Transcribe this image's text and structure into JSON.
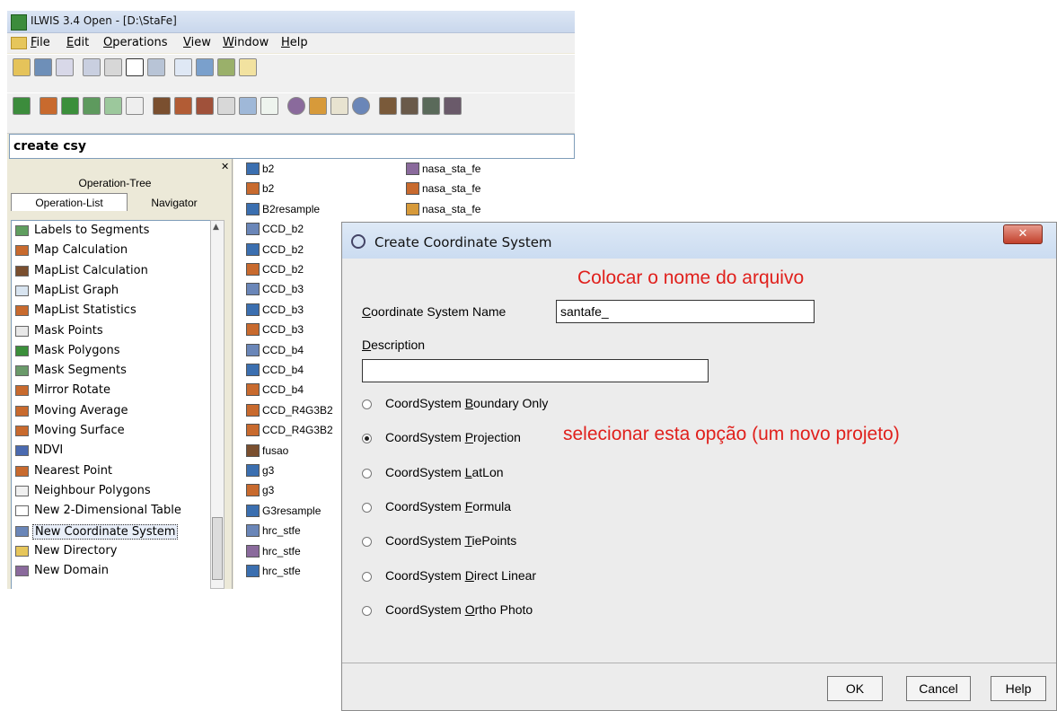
{
  "main_window": {
    "title": "ILWIS 3.4 Open - [D:\\StaFe]",
    "menu": [
      "File",
      "Edit",
      "Operations",
      "View",
      "Window",
      "Help"
    ],
    "command_line": "create csy",
    "panel_tabs": {
      "tree": "Operation-Tree",
      "list": "Operation-List",
      "navigator": "Navigator"
    },
    "operations": [
      "Labels to Segments",
      "Map Calculation",
      "MapList Calculation",
      "MapList Graph",
      "MapList Statistics",
      "Mask Points",
      "Mask Polygons",
      "Mask Segments",
      "Mirror Rotate",
      "Moving Average",
      "Moving Surface",
      "NDVI",
      "Nearest Point",
      "Neighbour Polygons",
      "New 2-Dimensional Table",
      "New Coordinate System",
      "New Directory",
      "New Domain"
    ],
    "selected_operation": "New Coordinate System",
    "catalog_col1": [
      "b2",
      "b2",
      "B2resample",
      "CCD_b2",
      "CCD_b2",
      "CCD_b2",
      "CCD_b3",
      "CCD_b3",
      "CCD_b3",
      "CCD_b4",
      "CCD_b4",
      "CCD_b4",
      "CCD_R4G3B2",
      "CCD_R4G3B2",
      "fusao",
      "g3",
      "g3",
      "G3resample",
      "hrc_stfe",
      "hrc_stfe",
      "hrc_stfe"
    ],
    "catalog_col2": [
      "nasa_sta_fe",
      "nasa_sta_fe",
      "nasa_sta_fe"
    ]
  },
  "dialog": {
    "title": "Create Coordinate System",
    "annotation_name": "Colocar o nome do arquivo",
    "name_label": "Coordinate System Name",
    "name_value": "santafe_",
    "description_label": "Description",
    "description_value": "",
    "options": [
      {
        "pre": "CoordSystem ",
        "key": "B",
        "post": "oundary Only",
        "checked": false
      },
      {
        "pre": "CoordSystem ",
        "key": "P",
        "post": "rojection",
        "checked": true
      },
      {
        "pre": "CoordSystem ",
        "key": "L",
        "post": "atLon",
        "checked": false
      },
      {
        "pre": "CoordSystem ",
        "key": "F",
        "post": "ormula",
        "checked": false
      },
      {
        "pre": "CoordSystem ",
        "key": "T",
        "post": "iePoints",
        "checked": false
      },
      {
        "pre": "CoordSystem ",
        "key": "D",
        "post": "irect Linear",
        "checked": false
      },
      {
        "pre": "CoordSystem ",
        "key": "O",
        "post": "rtho Photo",
        "checked": false
      }
    ],
    "annotation_option": "selecionar esta opção (um novo projeto)",
    "buttons": {
      "ok": "OK",
      "cancel": "Cancel",
      "help": "Help"
    }
  },
  "colors": {
    "annotation": "#e0201c",
    "selection": "#e8eef8"
  }
}
